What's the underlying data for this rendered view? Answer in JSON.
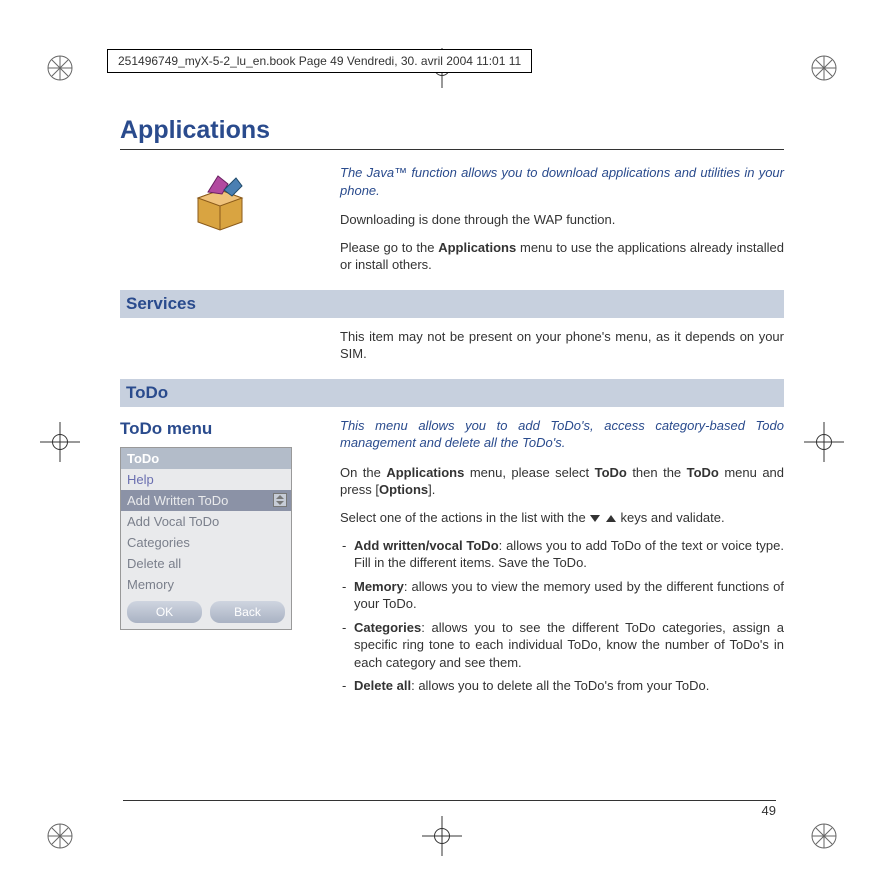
{
  "header_line": "251496749_myX-5-2_lu_en.book  Page 49  Vendredi, 30. avril 2004  11:01 11",
  "title": "Applications",
  "intro_italic": "The Java™ function allows you to download applications and utilities in your phone.",
  "intro_p2": "Downloading is done through the WAP function.",
  "intro_p3_pre": "Please go to the ",
  "intro_p3_bold": "Applications",
  "intro_p3_post": " menu to use the applications already installed or install others.",
  "section_services": "Services",
  "services_body": "This item may not be present on your phone's menu, as it depends on your SIM.",
  "section_todo": "ToDo",
  "todo_left_heading": "ToDo menu",
  "todo_intro_italic": "This menu allows you to add ToDo's, access category-based Todo management and delete all the ToDo's.",
  "todo_p_pre": "On the ",
  "todo_p_b1": "Applications",
  "todo_p_mid1": " menu, please select ",
  "todo_p_b2": "ToDo",
  "todo_p_mid2": " then the ",
  "todo_p_b3": "ToDo",
  "todo_p_mid3": " menu and press [",
  "todo_p_b4": "Options",
  "todo_p_post": "].",
  "todo_select_pre": "Select one of the actions in the list with the ",
  "todo_select_post": " keys and validate.",
  "bullets": {
    "b1": {
      "bold": "Add written/vocal ToDo",
      "rest": ": allows you to add ToDo of the text or voice type. Fill in the different items. Save the ToDo."
    },
    "b2": {
      "bold": "Memory",
      "rest": ": allows you to view the memory used by the different functions of your ToDo."
    },
    "b3": {
      "bold": "Categories",
      "rest": ": allows you to see the different ToDo categories, assign a specific ring tone to each individual ToDo, know the number of ToDo's in each category and see them."
    },
    "b4": {
      "bold": "Delete all",
      "rest": ": allows you to delete all the ToDo's from your ToDo."
    }
  },
  "phone": {
    "title": "ToDo",
    "rows": [
      "Help",
      "Add Written ToDo",
      "Add Vocal ToDo",
      "Categories",
      "Delete all",
      "Memory"
    ],
    "soft_left": "OK",
    "soft_right": "Back"
  },
  "page_number": "49"
}
